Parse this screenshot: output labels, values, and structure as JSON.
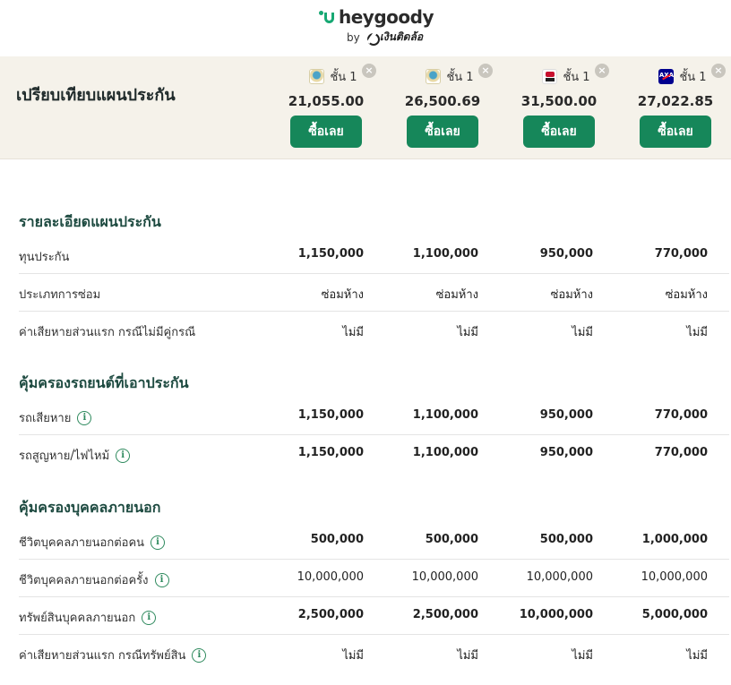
{
  "header": {
    "brand": "heygoody",
    "by": "by",
    "partner": "เงินติดล้อ"
  },
  "compare": {
    "title": "เปรียบเทียบแผนประกัน",
    "remove_symbol": "×",
    "plans": [
      {
        "class_label": "ชั้น 1",
        "price": "21,055.00",
        "buy_label": "ซื้อเลย",
        "logo": "insurer-logo-emblem"
      },
      {
        "class_label": "ชั้น 1",
        "price": "26,500.69",
        "buy_label": "ซื้อเลย",
        "logo": "insurer-logo-emblem"
      },
      {
        "class_label": "ชั้น 1",
        "price": "31,500.00",
        "buy_label": "ซื้อเลย",
        "logo": "insurer-logo-red-black"
      },
      {
        "class_label": "ชั้น 1",
        "price": "27,022.85",
        "buy_label": "ซื้อเลย",
        "logo": "axa-logo"
      }
    ]
  },
  "sections": {
    "plan_details": {
      "title": "รายละเอียดแผนประกัน",
      "rows": [
        {
          "label": "ทุนประกัน",
          "values": [
            "1,150,000",
            "1,100,000",
            "950,000",
            "770,000"
          ]
        },
        {
          "label": "ประเภทการซ่อม",
          "values": [
            "ซ่อมห้าง",
            "ซ่อมห้าง",
            "ซ่อมห้าง",
            "ซ่อมห้าง"
          ]
        },
        {
          "label": "ค่าเสียหายส่วนแรก กรณีไม่มีคู่กรณี",
          "values": [
            "ไม่มี",
            "ไม่มี",
            "ไม่มี",
            "ไม่มี"
          ]
        }
      ]
    },
    "vehicle_coverage": {
      "title": "คุ้มครองรถยนต์ที่เอาประกัน",
      "rows": [
        {
          "label": "รถเสียหาย",
          "values": [
            "1,150,000",
            "1,100,000",
            "950,000",
            "770,000"
          ]
        },
        {
          "label": "รถสูญหาย/ไฟไหม้",
          "values": [
            "1,150,000",
            "1,100,000",
            "950,000",
            "770,000"
          ]
        }
      ]
    },
    "third_party": {
      "title": "คุ้มครองบุคคลภายนอก",
      "rows": [
        {
          "label": "ชีวิตบุคคลภายนอกต่อคน",
          "values": [
            "500,000",
            "500,000",
            "500,000",
            "1,000,000"
          ]
        },
        {
          "label": "ชีวิตบุคคลภายนอกต่อครั้ง",
          "values": [
            "10,000,000",
            "10,000,000",
            "10,000,000",
            "10,000,000"
          ]
        },
        {
          "label": "ทรัพย์สินบุคคลภายนอก",
          "values": [
            "2,500,000",
            "2,500,000",
            "10,000,000",
            "5,000,000"
          ]
        },
        {
          "label": "ค่าเสียหายส่วนแรก กรณีทรัพย์สิน",
          "values": [
            "ไม่มี",
            "ไม่มี",
            "ไม่มี",
            "ไม่มี"
          ]
        }
      ]
    }
  },
  "info_icon_glyph": "i",
  "colors": {
    "accent": "#16875a",
    "brand_green": "#17a873",
    "section_title": "#1d4a40",
    "compare_bg": "#f5f2ea"
  }
}
